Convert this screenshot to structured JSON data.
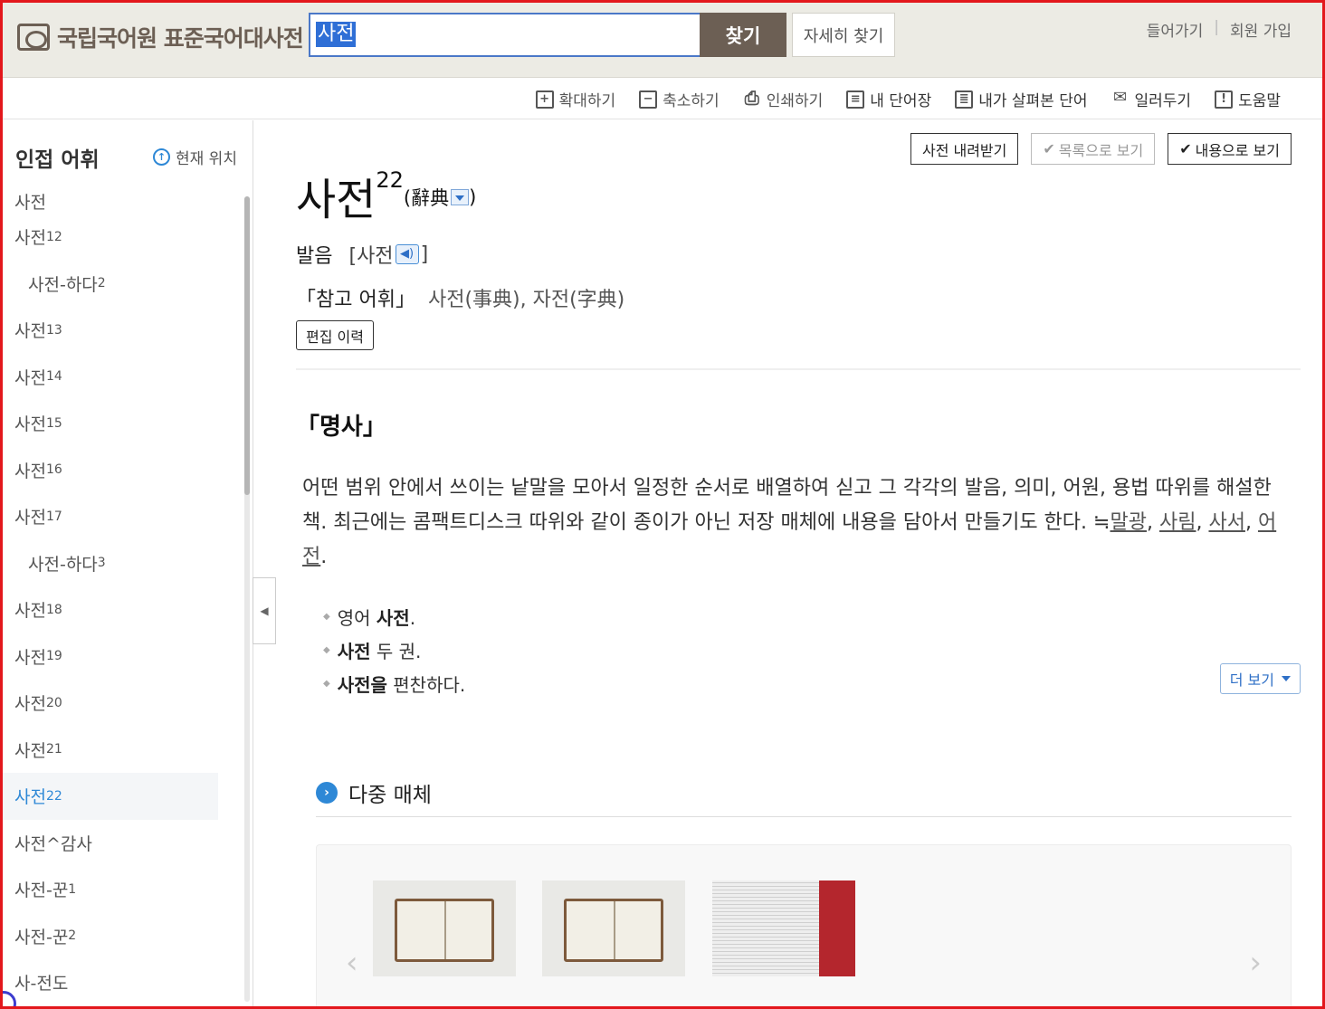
{
  "header": {
    "logo_text": "국립국어원 표준국어대사전",
    "search_value": "사전",
    "search_button": "찾기",
    "advanced_button": "자세히 찾기",
    "login": "들어가기",
    "signup": "회원 가입",
    "separator": "|"
  },
  "toolbar": {
    "items": [
      {
        "icon": "+",
        "label": "확대하기"
      },
      {
        "icon": "−",
        "label": "축소하기"
      },
      {
        "icon": "⎙",
        "label": "인쇄하기"
      },
      {
        "icon": "≡",
        "label": "내 단어장"
      },
      {
        "icon": "≣",
        "label": "내가 살펴본 단어"
      },
      {
        "icon": "✉",
        "label": "일러두기"
      },
      {
        "icon": "!",
        "label": "도움말"
      }
    ]
  },
  "sidebar": {
    "title": "인접 어휘",
    "location_label": "현재 위치",
    "location_icon": "↑",
    "items": [
      {
        "word": "사전",
        "sup": "",
        "sub": false,
        "cut": true
      },
      {
        "word": "사전",
        "sup": "12",
        "sub": false
      },
      {
        "word": "사전-하다",
        "sup": "2",
        "sub": true
      },
      {
        "word": "사전",
        "sup": "13",
        "sub": false
      },
      {
        "word": "사전",
        "sup": "14",
        "sub": false
      },
      {
        "word": "사전",
        "sup": "15",
        "sub": false
      },
      {
        "word": "사전",
        "sup": "16",
        "sub": false
      },
      {
        "word": "사전",
        "sup": "17",
        "sub": false
      },
      {
        "word": "사전-하다",
        "sup": "3",
        "sub": true
      },
      {
        "word": "사전",
        "sup": "18",
        "sub": false
      },
      {
        "word": "사전",
        "sup": "19",
        "sub": false
      },
      {
        "word": "사전",
        "sup": "20",
        "sub": false
      },
      {
        "word": "사전",
        "sup": "21",
        "sub": false
      },
      {
        "word": "사전",
        "sup": "22",
        "sub": false,
        "active": true
      },
      {
        "word": "사전^감사",
        "sup": "",
        "sub": false
      },
      {
        "word": "사전-꾼",
        "sup": "1",
        "sub": false
      },
      {
        "word": "사전-꾼",
        "sup": "2",
        "sub": false
      },
      {
        "word": "사-전도",
        "sup": "",
        "sub": false
      }
    ]
  },
  "entry": {
    "actions": {
      "download": "사전 내려받기",
      "list_view": "목록으로 보기",
      "content_view": "내용으로 보기"
    },
    "headword": "사전",
    "homonym_number": "22",
    "hanja": "(辭典",
    "hanja_close": ")",
    "pron_label": "발음",
    "pron_open": "[사전",
    "pron_close": "]",
    "ref_label": "「참고 어휘」",
    "ref_value": "사전(事典), 자전(字典)",
    "history_button": "편집 이력",
    "pos": "「명사」",
    "definition": "어떤 범위 안에서 쓰이는 낱말을 모아서 일정한 순서로 배열하여 싣고 그 각각의 발음, 의미, 어원, 용법 따위를 해설한 책. 최근에는 콤팩트디스크 따위와 같이 종이가 아닌 저장 매체에 내용을 담아서 만들기도 한다. ",
    "synonym_mark": "≒",
    "synonyms": [
      "말광",
      "사림",
      "사서",
      "어전"
    ],
    "examples": [
      {
        "before": "영어 ",
        "bold": "사전",
        "after": "."
      },
      {
        "before": "",
        "bold": "사전",
        "after": " 두 권."
      },
      {
        "before": "",
        "bold": "사전을",
        "after": " 편찬하다."
      }
    ],
    "more_button": "더 보기",
    "media_title": "다중 매체",
    "media_icon": "›"
  },
  "colors": {
    "header_bg": "#ecebe4",
    "brand": "#6c5f54",
    "accent": "#2e88d6",
    "frame": "#e3171c"
  }
}
